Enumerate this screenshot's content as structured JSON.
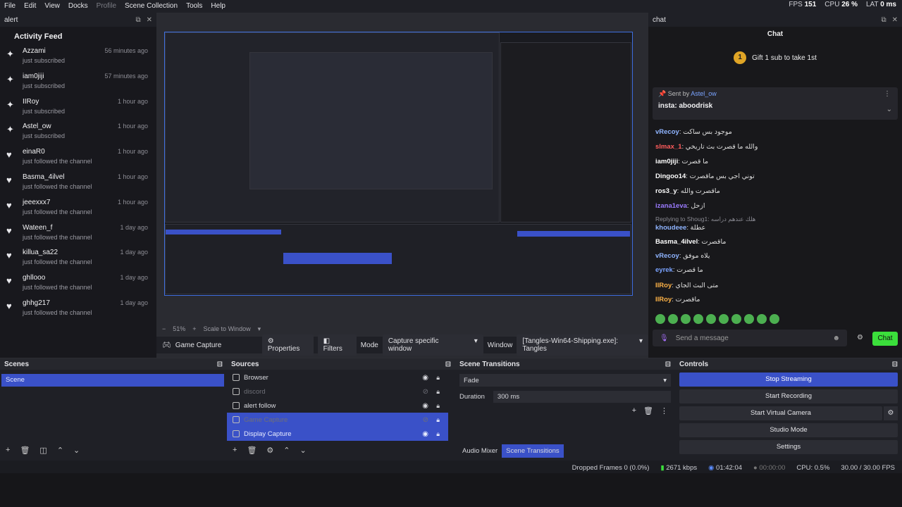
{
  "menubar": {
    "items": [
      "File",
      "Edit",
      "View",
      "Docks",
      "Profile",
      "Scene Collection",
      "Tools",
      "Help"
    ],
    "stats": {
      "fps_label": "FPS",
      "fps": "151",
      "cpu_label": "CPU",
      "cpu": "26 %",
      "lat_label": "LAT",
      "lat": "0 ms"
    }
  },
  "alert": {
    "dock_title": "alert",
    "feed_title": "Activity Feed",
    "items": [
      {
        "name": "Azzami",
        "desc": "just subscribed",
        "time": "56 minutes ago",
        "icon": "star-icon"
      },
      {
        "name": "iam0jiji",
        "desc": "just subscribed",
        "time": "57 minutes ago",
        "icon": "star-icon"
      },
      {
        "name": "IIRoy",
        "desc": "just subscribed",
        "time": "1 hour ago",
        "icon": "star-icon"
      },
      {
        "name": "Astel_ow",
        "desc": "just subscribed",
        "time": "1 hour ago",
        "icon": "star-icon"
      },
      {
        "name": "einaR0",
        "desc": "just followed the channel",
        "time": "1 hour ago",
        "icon": "heart-icon"
      },
      {
        "name": "Basma_4ilvel",
        "desc": "just followed the channel",
        "time": "1 hour ago",
        "icon": "heart-icon"
      },
      {
        "name": "jeeexxx7",
        "desc": "just followed the channel",
        "time": "1 hour ago",
        "icon": "heart-icon"
      },
      {
        "name": "Wateen_f",
        "desc": "just followed the channel",
        "time": "1 day ago",
        "icon": "heart-icon"
      },
      {
        "name": "killua_sa22",
        "desc": "just followed the channel",
        "time": "1 day ago",
        "icon": "heart-icon"
      },
      {
        "name": "ghllooo",
        "desc": "just followed the channel",
        "time": "1 day ago",
        "icon": "heart-icon"
      },
      {
        "name": "ghhg217",
        "desc": "just followed the channel",
        "time": "1 day ago",
        "icon": "heart-icon"
      }
    ]
  },
  "preview": {
    "zoom": "51%",
    "scale_mode": "Scale to Window"
  },
  "source_toolbar": {
    "source_name": "Game Capture",
    "properties": "Properties",
    "filters": "Filters",
    "mode_label": "Mode",
    "mode_value": "Capture specific window",
    "window_label": "Window",
    "window_value": "[Tangles-Win64-Shipping.exe]: Tangles"
  },
  "chat": {
    "dock_title": "chat",
    "title": "Chat",
    "gift_rank": "1",
    "gift_text": "Gift 1 sub to take 1st",
    "pinned_by_label": "Sent by",
    "pinned_by": "Astel_ow",
    "pinned_msg": "insta: aboodrisk",
    "lines": [
      {
        "user": "vRecoy",
        "color": "#8fb4ff",
        "msg": "موجود بس ساكت"
      },
      {
        "user": "slmax_1",
        "color": "#ff5c5c",
        "msg": "والله ما قصرت بث تاريخي"
      },
      {
        "user": "iam0jiji",
        "color": "#ffffff",
        "msg": "ما قصرت"
      },
      {
        "user": "Dingoo14",
        "color": "#ffffff",
        "msg": "توني اجي بس ماقصرت"
      },
      {
        "user": "ros3_y",
        "color": "#ffffff",
        "msg": "ماقصرت والله"
      },
      {
        "user": "izana1eva",
        "color": "#9b7bff",
        "msg": "ازحل"
      },
      {
        "user": "khoudeee",
        "color": "#8fb4ff",
        "msg": "عطلة"
      },
      {
        "user": "Basma_4ilvel",
        "color": "#ffffff",
        "msg": "ماقصرت"
      },
      {
        "user": "vRecoy",
        "color": "#8fb4ff",
        "msg": "يلاه موفق"
      },
      {
        "user": "eyrek",
        "color": "#7aa3ff",
        "msg": "ما قصرت"
      },
      {
        "user": "IIRoy",
        "color": "#ffb347",
        "msg": "متى البث الجاي"
      },
      {
        "user": "IIRoy",
        "color": "#ffb347",
        "msg": "ماقصرت"
      }
    ],
    "reply_note": "Replying to Shoug1: هلك عندهم دراسه",
    "input_placeholder": "Send a message",
    "send_label": "Chat"
  },
  "scenes": {
    "title": "Scenes",
    "items": [
      "Scene"
    ]
  },
  "sources": {
    "title": "Sources",
    "items": [
      {
        "name": "Browser",
        "hidden": false,
        "selected": false
      },
      {
        "name": "discord",
        "hidden": true,
        "selected": false
      },
      {
        "name": "alert follow",
        "hidden": false,
        "selected": false
      },
      {
        "name": "Game Capture",
        "hidden": true,
        "selected": true
      },
      {
        "name": "Display Capture",
        "hidden": false,
        "selected": true
      }
    ]
  },
  "transitions": {
    "title": "Scene Transitions",
    "type": "Fade",
    "duration_label": "Duration",
    "duration": "300 ms",
    "tab_mixer": "Audio Mixer",
    "tab_transitions": "Scene Transitions"
  },
  "controls": {
    "title": "Controls",
    "buttons": [
      "Stop Streaming",
      "Start Recording",
      "Start Virtual Camera",
      "Studio Mode",
      "Settings"
    ]
  },
  "status": {
    "dropped": "Dropped Frames 0 (0.0%)",
    "kbps": "2671 kbps",
    "stream_time": "01:42:04",
    "rec_time": "00:00:00",
    "cpu": "CPU: 0.5%",
    "fps": "30.00 / 30.00 FPS"
  }
}
